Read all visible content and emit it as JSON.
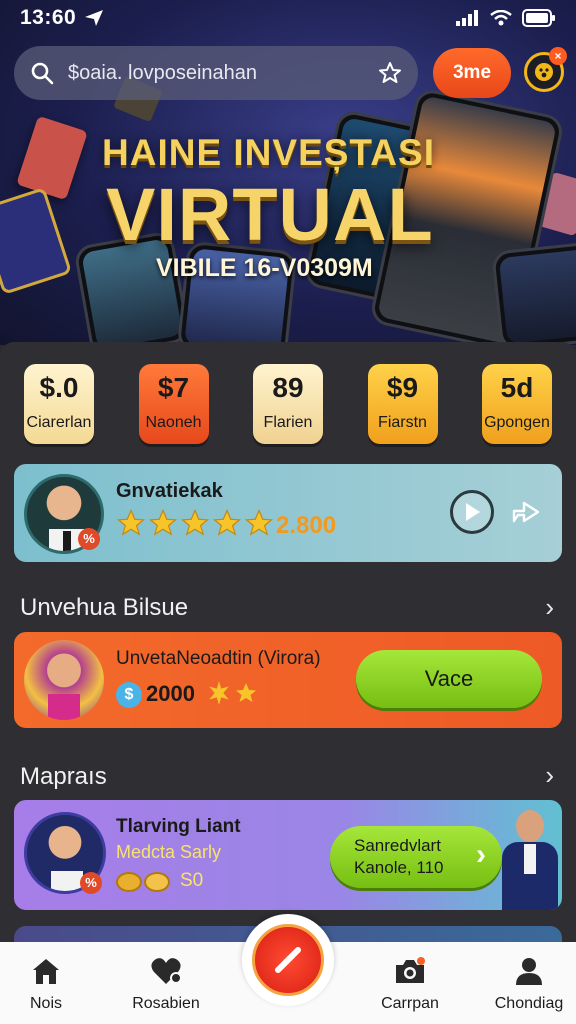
{
  "status_bar": {
    "time": "13:60"
  },
  "search": {
    "text": "$oaia. lovposeinahan"
  },
  "header_pill": {
    "label": "3me"
  },
  "hero": {
    "line1": "HAINE INVEȘTASI",
    "line2": "VIRTUAL",
    "line3": "VIBILE 16-V0309M"
  },
  "tiles": [
    {
      "value": "$.0",
      "label": "Ciarerlan",
      "color": "#f6e3b0"
    },
    {
      "value": "$7",
      "label": "Naoneh",
      "color": "#f0642a"
    },
    {
      "value": "89",
      "label": "Flarien",
      "color": "#f7e2ad"
    },
    {
      "value": "$9",
      "label": "Fiarstn",
      "color": "#f6b623"
    },
    {
      "value": "5d",
      "label": "Gpongen",
      "color": "#f5b226"
    }
  ],
  "featured": {
    "name": "Gnvatiekak",
    "score": "2.800",
    "rating_stars": 5
  },
  "section1": {
    "title": "Unvehua Bilsue"
  },
  "promo": {
    "title": "UnvetaNeoadtin (Virora)",
    "amount": "2000",
    "button_label": "Vace"
  },
  "section2": {
    "title": "Mapraıs"
  },
  "offer": {
    "title": "Tlarving Liant",
    "subtitle": "Medcta Sarly",
    "coins": "S0",
    "cta_line1": "Sanredvlart",
    "cta_line2": "Kanole, 110"
  },
  "bottom_nav": {
    "items": [
      {
        "label": "Nois",
        "icon": "home-icon"
      },
      {
        "label": "Rosabien",
        "icon": "heart-icon"
      },
      {
        "label": "Carrpan",
        "icon": "camera-icon"
      },
      {
        "label": "Chondiag",
        "icon": "user-icon"
      }
    ]
  },
  "colors": {
    "accent_orange": "#f0642a",
    "accent_green": "#8fd21e",
    "gold": "#f5d25e",
    "nav_bg": "#fafafa"
  }
}
